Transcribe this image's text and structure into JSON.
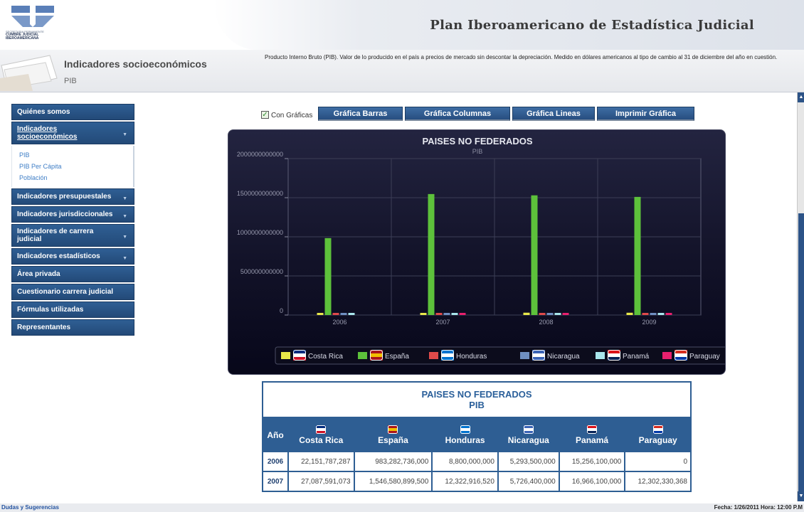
{
  "header": {
    "site_title": "Plan Iberoamericano de Estadística Judicial",
    "logo_text_1": "SECRETARIA PERMANENTE",
    "logo_text_2": "CUMBRE JUDICIAL",
    "logo_text_3": "IBEROAMERICANA"
  },
  "subheader": {
    "title": "Indicadores socioeconómicos",
    "subtitle": "PIB",
    "description": "Producto Interno Bruto (PIB). Valor de lo producido en el país a precios de mercado sin descontar la depreciación. Medido en dólares americanos al tipo de cambio al 31 de diciembre del año en cuestión."
  },
  "sidebar": {
    "items": [
      {
        "label": "Quiénes somos"
      },
      {
        "label": "Indicadores socioeconómicos"
      },
      {
        "label": "Indicadores presupuestales"
      },
      {
        "label": "Indicadores jurisdiccionales"
      },
      {
        "label": "Indicadores de carrera judicial"
      },
      {
        "label": "Indicadores estadísticos"
      },
      {
        "label": "Área privada"
      },
      {
        "label": "Cuestionario carrera judicial"
      },
      {
        "label": "Fórmulas utilizadas"
      },
      {
        "label": "Representantes"
      }
    ],
    "subitems": [
      {
        "label": "PIB"
      },
      {
        "label": "PIB Per Cápita"
      },
      {
        "label": "Población"
      }
    ]
  },
  "toolbar": {
    "checkbox_label": "Con Gráficas",
    "checkbox_checked": true,
    "buttons": [
      {
        "label": "Gráfica Barras"
      },
      {
        "label": "Gráfica Columnas"
      },
      {
        "label": "Gráfica Lineas"
      },
      {
        "label": "Imprimir Gráfica"
      }
    ]
  },
  "colors": {
    "nav_bg": "#2a5486",
    "accent": "#2e5e93",
    "link": "#3f7ec6"
  },
  "chart_data": {
    "type": "bar",
    "title": "PAISES NO FEDERADOS",
    "subtitle": "PIB",
    "categories": [
      "2006",
      "2007",
      "2008",
      "2009"
    ],
    "ylim": [
      0,
      2000000000000
    ],
    "yticks": [
      "0",
      "500000000000",
      "1000000000000",
      "1500000000000",
      "2000000000000"
    ],
    "grid": true,
    "legend_position": "bottom",
    "series": [
      {
        "name": "Costa Rica",
        "color": "#e8e84a",
        "values": [
          22151787287,
          27087591073,
          29800000000,
          29200000000
        ]
      },
      {
        "name": "España",
        "color": "#5dc13b",
        "values": [
          983282736000,
          1546580899500,
          1530000000000,
          1510000000000
        ]
      },
      {
        "name": "Honduras",
        "color": "#e04a4a",
        "values": [
          8800000000,
          12322916520,
          14000000000,
          14300000000
        ]
      },
      {
        "name": "Nicaragua",
        "color": "#6f8fc2",
        "values": [
          5293500000,
          5726400000,
          6500000000,
          6200000000
        ]
      },
      {
        "name": "Panamá",
        "color": "#a9e6ec",
        "values": [
          15256100000,
          16966100000,
          19800000000,
          24000000000
        ]
      },
      {
        "name": "Paraguay",
        "color": "#e8206e",
        "values": [
          0,
          12302330368,
          16000000000,
          14200000000
        ]
      }
    ]
  },
  "table": {
    "title": "PAISES NO FEDERADOS",
    "subtitle": "PIB",
    "year_header": "Año",
    "headers": [
      "Costa Rica",
      "España",
      "Honduras",
      "Nicaragua",
      "Panamá",
      "Paraguay"
    ],
    "rows": [
      {
        "year": "2006",
        "values": [
          "22,151,787,287",
          "983,282,736,000",
          "8,800,000,000",
          "5,293,500,000",
          "15,256,100,000",
          "0"
        ]
      },
      {
        "year": "2007",
        "values": [
          "27,087,591,073",
          "1,546,580,899,500",
          "12,322,916,520",
          "5,726,400,000",
          "16,966,100,000",
          "12,302,330,368"
        ]
      }
    ]
  },
  "footer": {
    "link": "Dudas y Sugerencias",
    "date_text": "Fecha: 1/26/2011 Hora: 12:00 P.M"
  }
}
